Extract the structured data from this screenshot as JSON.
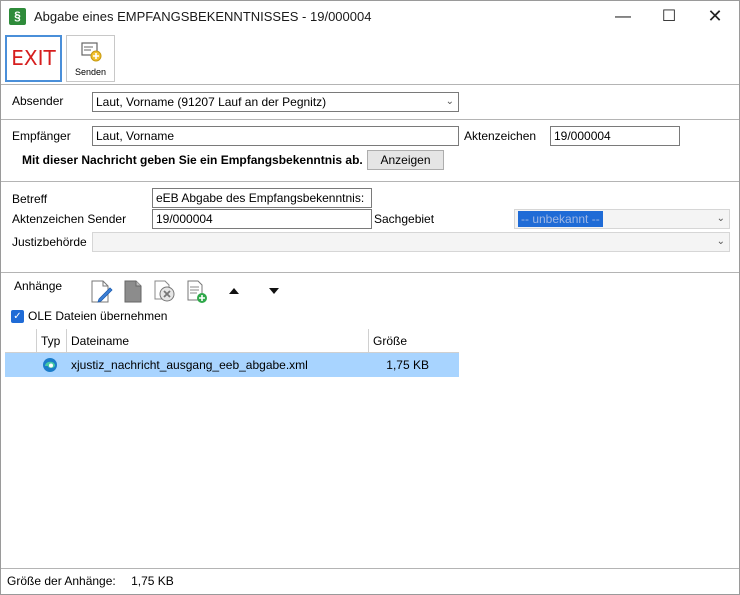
{
  "window": {
    "title": "Abgabe eines EMPFANGSBEKENNTNISSES - 19/000004",
    "app_icon_glyph": "§",
    "minimize_glyph": "—",
    "maximize_glyph": "☐",
    "close_glyph": "✕"
  },
  "toolbar": {
    "exit_label": "EXIT",
    "send_label": "Senden"
  },
  "sender": {
    "label": "Absender",
    "value": "Laut, Vorname (91207 Lauf an der Pegnitz)"
  },
  "recipient": {
    "label": "Empfänger",
    "value": "Laut, Vorname",
    "aktenzeichen_label": "Aktenzeichen",
    "aktenzeichen_value": "19/000004",
    "notice": "Mit dieser Nachricht geben Sie ein Empfangsbekenntnis ab.",
    "show_button": "Anzeigen"
  },
  "details": {
    "betreff_label": "Betreff",
    "betreff_value": "eEB Abgabe des Empfangsbekenntnis:",
    "az_sender_label": "Aktenzeichen Sender",
    "az_sender_value": "19/000004",
    "sachgebiet_label": "Sachgebiet",
    "sachgebiet_value": "-- unbekannt --",
    "justiz_label": "Justizbehörde",
    "justiz_value": ""
  },
  "attachments": {
    "label": "Anhänge",
    "ole_label": "OLE Dateien übernehmen",
    "ole_checked": true,
    "columns": [
      "Typ",
      "Dateiname",
      "Größe"
    ],
    "rows": [
      {
        "type_icon": "edge-icon",
        "filename": "xjustiz_nachricht_ausgang_eeb_abgabe.xml",
        "size": "1,75 KB"
      }
    ]
  },
  "status": {
    "label": "Größe der Anhänge:",
    "value": "1,75 KB"
  },
  "colors": {
    "exit_text": "#d61e1e",
    "selection": "#a8d4ff",
    "accent": "#1f6bd6"
  }
}
